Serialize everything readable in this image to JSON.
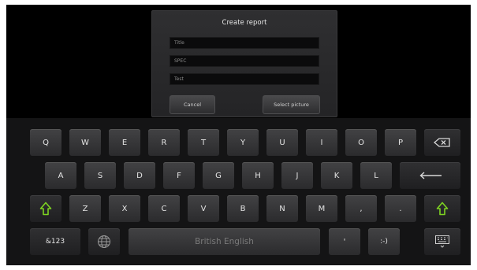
{
  "dialog": {
    "title": "Create report",
    "fields": [
      {
        "placeholder": "Title"
      },
      {
        "placeholder": "SPEC"
      },
      {
        "placeholder": "Test"
      }
    ],
    "cancel_label": "Cancel",
    "select_picture_label": "Select picture"
  },
  "keyboard": {
    "row1": [
      "Q",
      "W",
      "E",
      "R",
      "T",
      "Y",
      "U",
      "I",
      "O",
      "P"
    ],
    "row2": [
      "A",
      "S",
      "D",
      "F",
      "G",
      "H",
      "J",
      "K",
      "L"
    ],
    "row3": [
      "Z",
      "X",
      "C",
      "V",
      "B",
      "N",
      "M",
      ",",
      "."
    ],
    "symbols_label": "&123",
    "space_label": "British English",
    "apostrophe_label": "'",
    "smiley_label": ":-)",
    "icons": {
      "backspace": "backspace-icon",
      "enter": "enter-icon",
      "shift": "shift-arrow-icon",
      "globe": "globe-icon",
      "hide_keyboard": "hide-keyboard-icon"
    },
    "shift_color": "#7ed321"
  }
}
